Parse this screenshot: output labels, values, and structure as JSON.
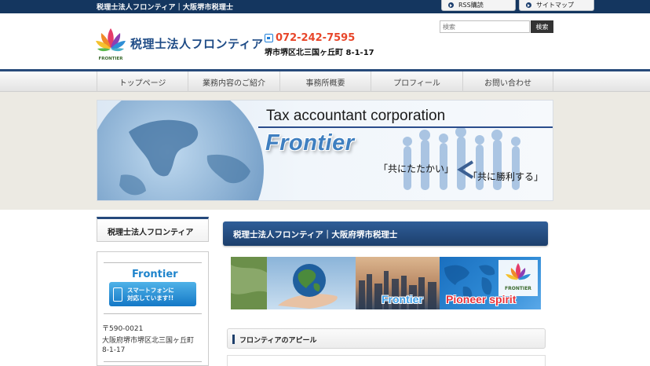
{
  "topbar": {
    "tagline": "税理士法人フロンティア｜大阪堺市税理士",
    "rss_label": "RSS購読",
    "sitemap_label": "サイトマップ"
  },
  "header": {
    "logo_text": "税理士法人フロンティア",
    "logo_small": "FRONTIER",
    "phone": "072-242-7595",
    "address": "堺市堺区北三国ヶ丘町 8-1-17",
    "search_placeholder": "検索",
    "search_button": "検索"
  },
  "nav": {
    "items": [
      "トップページ",
      "業務内容のご紹介",
      "事務所概要",
      "プロフィール",
      "お問い合わせ"
    ]
  },
  "hero": {
    "title": "Tax accountant corporation",
    "logo": "Frontier",
    "slogan1": "「共にたたかい」",
    "slogan2": "「共に勝利する」"
  },
  "sidebar": {
    "box_title": "税理士法人フロンティア",
    "frontier_label": "Frontier",
    "smartphone_line1": "スマートフォンに",
    "smartphone_line2": "対応しています!!",
    "postal": "〒590-0021",
    "address_line1": "大阪府堺市堺区北三国ヶ丘町",
    "address_line2": "8-1-17"
  },
  "main": {
    "heading": "税理士法人フロンティア｜大阪府堺市税理士",
    "banner_frontier": "Frontier",
    "banner_pioneer": "Pioneer spirit",
    "banner_logo_small": "FRONTIER",
    "appeal_title": "フロンティアのアピール"
  },
  "colors": {
    "navy": "#14365f",
    "accent_red": "#e8462a",
    "accent_blue": "#1f84cc"
  }
}
